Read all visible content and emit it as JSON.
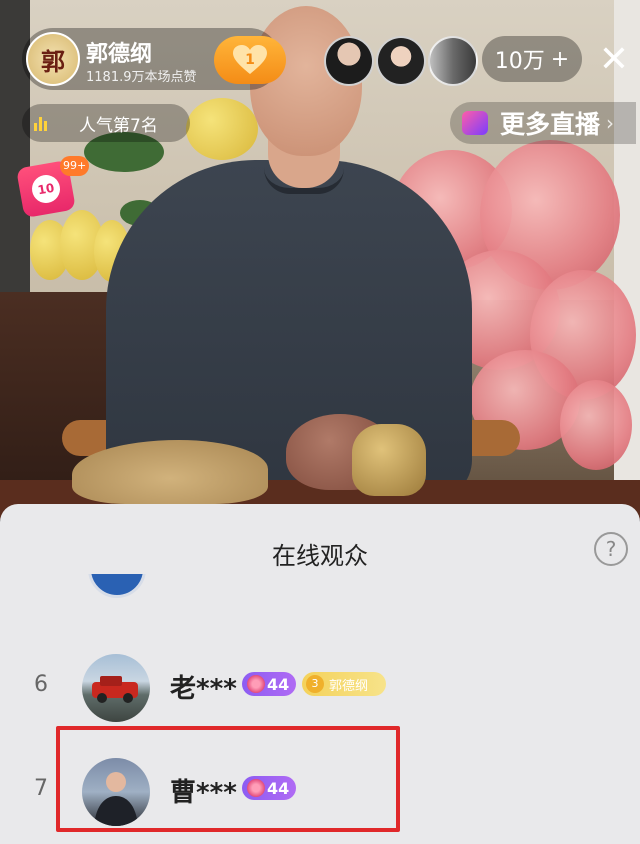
{
  "live_overlay": {
    "host": {
      "avatar_text": "郭",
      "name": "郭德纲",
      "likes": "1181.9万本场点赞",
      "follow_count": "1"
    },
    "viewer_count": "10万",
    "viewer_plus": "+",
    "close_icon": "close-icon",
    "popularity": "人气第7名",
    "more_live": "更多直播",
    "gift_count": "99+",
    "gift_inner": "10"
  },
  "audience_sheet": {
    "title": "在线观众",
    "help_icon": "?",
    "rows": [
      {
        "rank": "6",
        "name": "老***",
        "level": "44",
        "fan_level": "3",
        "fan_tag": "郭德纲"
      },
      {
        "rank": "7",
        "name": "曹***",
        "level": "44"
      }
    ]
  },
  "colors": {
    "highlight_border": "#e0282a",
    "follow_button": "#f48c16",
    "level_badge": "#8c5cf2",
    "fan_badge": "#f4d25b"
  }
}
